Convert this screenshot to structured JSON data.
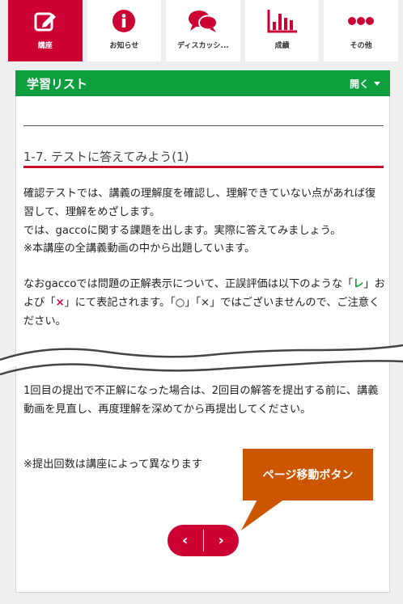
{
  "tabs": [
    {
      "label": "講座",
      "icon": "pencil-icon",
      "active": true
    },
    {
      "label": "お知らせ",
      "icon": "info-icon",
      "active": false
    },
    {
      "label": "ディスカッシ...",
      "icon": "chat-bubbles-icon",
      "active": false
    },
    {
      "label": "成績",
      "icon": "bar-chart-icon",
      "active": false
    },
    {
      "label": "その他",
      "icon": "more-dots-icon",
      "active": false
    }
  ],
  "study_list": {
    "title": "学習リスト",
    "toggle_label": "開く"
  },
  "lesson": {
    "title": "1-7. テストに答えてみよう(1)",
    "p1": "確認テストでは、講義の理解度を確認し、理解できていない点があれば復習して、理解をめざします。",
    "p1b": "では、gaccoに関する課題を出します。実際に答えてみましょう。",
    "p1c": "※本講座の全講義動画の中から出題しています。",
    "p2_pre": "なおgaccoでは問題の正解表示について、正誤評価は以下のような「",
    "p2_check": "レ",
    "p2_mid": "」および「",
    "p2_x": "×",
    "p2_post": "」にて表記されます。「○」「×」ではございませんので、ご注意ください。",
    "p3": "1回目の提出で不正解になった場合は、2回目の解答を提出する前に、講義動画を見直し、再度理解を深めてから再提出してください。",
    "p4": "※提出回数は講座によって異なります"
  },
  "pager": {
    "prev": "‹",
    "next": "›"
  },
  "callout": {
    "text": "ページ移動ボタン"
  },
  "colors": {
    "brand_red": "#cc0033",
    "header_green": "#0d9e3d",
    "callout_orange": "#cc5500"
  }
}
